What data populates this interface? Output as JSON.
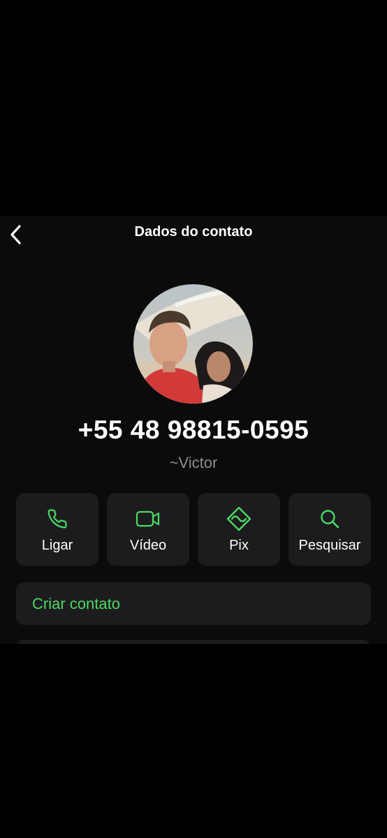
{
  "header": {
    "title": "Dados do contato",
    "back_icon": "chevron-left-icon"
  },
  "profile": {
    "phone_number": "+55 48 98815-0595",
    "push_name": "~Victor"
  },
  "actions": [
    {
      "label": "Ligar",
      "icon": "phone-icon"
    },
    {
      "label": "Vídeo",
      "icon": "video-camera-icon"
    },
    {
      "label": "Pix",
      "icon": "pix-icon"
    },
    {
      "label": "Pesquisar",
      "icon": "search-icon"
    }
  ],
  "create_contact": {
    "label": "Criar contato"
  },
  "colors": {
    "accent": "#4cd964",
    "background": "#0b0b0b",
    "card": "#1c1c1e",
    "secondary_text": "#8e8e93"
  }
}
